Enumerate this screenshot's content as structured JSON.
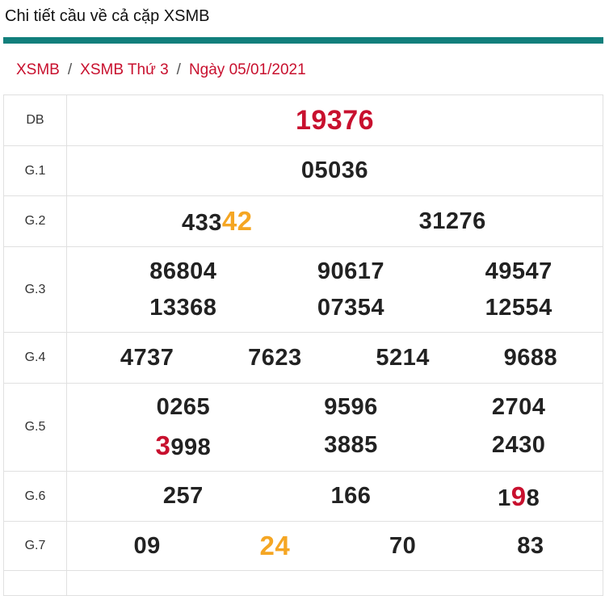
{
  "header": {
    "title": "Chi tiết cầu về cả cặp XSMB"
  },
  "breadcrumb": {
    "items": [
      "XSMB",
      "XSMB Thứ 3",
      "Ngày 05/01/2021"
    ],
    "separator": "/"
  },
  "colors": {
    "accent_bar": "#127f7c",
    "highlight_red": "#c8102e",
    "highlight_orange": "#f5a623"
  },
  "results": {
    "db": {
      "label": "DB",
      "number": "19376"
    },
    "g1": {
      "label": "G.1",
      "numbers": [
        "05036"
      ]
    },
    "g2": {
      "label": "G.2",
      "n1_prefix": "433",
      "n1_highlight": "42",
      "n2": "31276"
    },
    "g3": {
      "label": "G.3",
      "numbers": [
        "86804",
        "90617",
        "49547",
        "13368",
        "07354",
        "12554"
      ]
    },
    "g4": {
      "label": "G.4",
      "numbers": [
        "4737",
        "7623",
        "5214",
        "9688"
      ]
    },
    "g5": {
      "label": "G.5",
      "n1": "0265",
      "n2": "9596",
      "n3": "2704",
      "n4_highlight": "3",
      "n4_rest": "998",
      "n5": "3885",
      "n6": "2430"
    },
    "g6": {
      "label": "G.6",
      "n1": "257",
      "n2": "166",
      "n3_prefix": "1",
      "n3_highlight": "9",
      "n3_suffix": "8"
    },
    "g7": {
      "label": "G.7",
      "n1": "09",
      "n2_highlight": "24",
      "n3": "70",
      "n4": "83"
    }
  }
}
